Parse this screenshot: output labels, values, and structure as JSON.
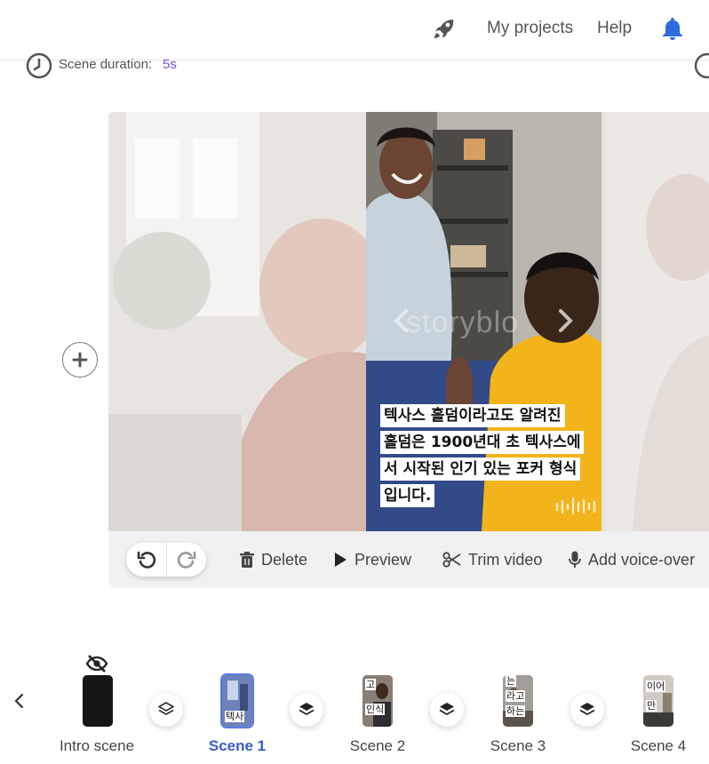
{
  "header": {
    "nav": [
      {
        "label": "My projects"
      },
      {
        "label": "Help"
      }
    ],
    "accent_color": "#2f6be0"
  },
  "scene_settings": {
    "duration_label": "Scene duration:",
    "duration_value": "5s"
  },
  "canvas": {
    "watermark": "storyblo",
    "subtitle_lines": [
      "텍사스 홀덤이라고도 알려진",
      "홀덤은 1900년대 초 텍사스에",
      "서 시작된 인기 있는 포커 형식",
      "입니다."
    ]
  },
  "toolbar": {
    "delete_label": "Delete",
    "preview_label": "Preview",
    "trim_label": "Trim video",
    "voiceover_label": "Add voice-over"
  },
  "scenes": [
    {
      "label": "Intro scene",
      "thumb_text": [],
      "hidden": true
    },
    {
      "label": "Scene 1",
      "thumb_text": [
        "텍사"
      ],
      "active": true
    },
    {
      "label": "Scene 2",
      "thumb_text": [
        "고",
        "인식"
      ]
    },
    {
      "label": "Scene 3",
      "thumb_text": [
        "는",
        "라고",
        "하는"
      ]
    },
    {
      "label": "Scene 4",
      "thumb_text": [
        "이어",
        "만"
      ]
    }
  ]
}
